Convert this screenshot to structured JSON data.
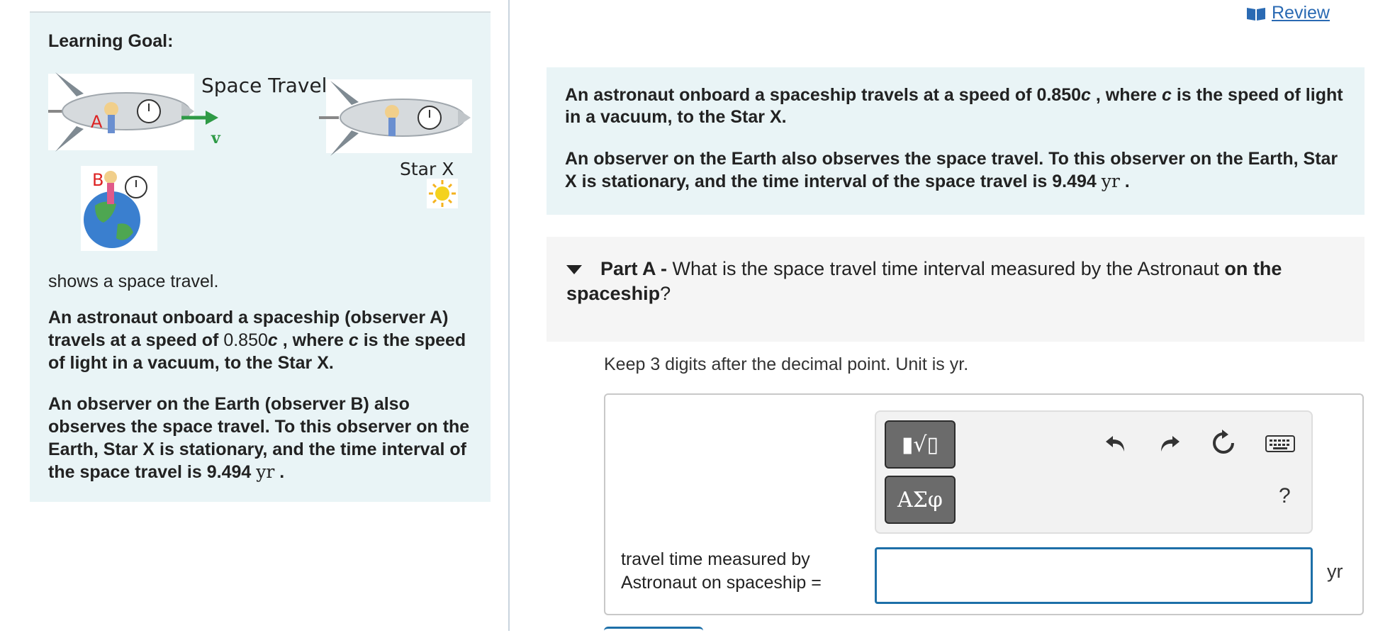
{
  "left": {
    "goal_title": "Learning Goal:",
    "figure": {
      "title": "Space Travel",
      "label_a": "A",
      "label_b": "B",
      "label_v": "v",
      "label_star": "Star X"
    },
    "caption": "shows a space travel.",
    "para1_part1": "An astronaut onboard a spaceship (observer A) travels at a speed of ",
    "para1_speed": "0.850",
    "para1_c1": "c",
    "para1_part2": " , where ",
    "para1_c2": "c",
    "para1_part3": " is the speed of light in a vacuum, to the Star X.",
    "para2_part1": "An observer on the Earth (observer B) also observes the space travel. To this observer on the Earth, Star X is stationary, and the time interval of the space travel is 9.494 ",
    "para2_unit": "yr",
    "para2_end": " ."
  },
  "header": {
    "review_label": "Review"
  },
  "intro": {
    "p1_part1": "An astronaut onboard a spaceship travels at a speed of 0.850",
    "p1_c1": "c",
    "p1_part2": " , where ",
    "p1_c2": "c",
    "p1_part3": " is the speed of light in a vacuum, to the Star X.",
    "p2_part1": "An observer on the Earth also observes the space travel. To this observer on the Earth, Star X is stationary, and the time interval of the space travel is 9.494 ",
    "p2_unit": "yr",
    "p2_end": " ."
  },
  "part_a": {
    "label": "Part A -",
    "question_part1": " What is the space travel time interval measured by the Astronaut ",
    "question_bold": "on the spaceship",
    "question_end": "?"
  },
  "instruction": "Keep 3 digits after the decimal point. Unit is yr.",
  "answer": {
    "templates_button": "▮√▯",
    "symbols_button": "ΑΣφ",
    "help": "?",
    "label_line1": "travel time measured by",
    "label_line2": "Astronaut on spaceship =",
    "value": "",
    "unit": "yr"
  },
  "colors": {
    "panel_bg": "#e9f4f6",
    "link": "#2a6ab3",
    "input_border": "#1d6fa8",
    "label_red": "#dd2222",
    "arrow_green": "#2e9a46"
  }
}
